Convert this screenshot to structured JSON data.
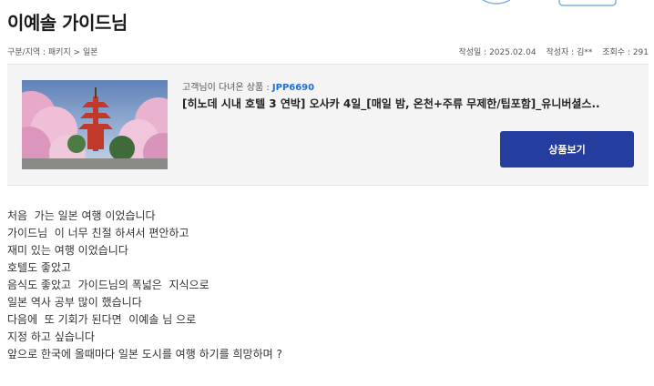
{
  "title": "이예솔 가이드님",
  "breadcrumb": "구분/지역 : 패키지 > 일본",
  "meta": {
    "date": "작성일 : 2025.02.04",
    "author": "작성자 : 김**",
    "views": "조회수 : 291"
  },
  "product": {
    "label": "고객님이 다녀온 상품 : ",
    "code": "JPP6690",
    "title": "[히노데 시내 호텔 3 연박] 오사카 4일_[매일 밤, 온천+주류 무제한/팁포함]_유니버셜스..",
    "button_label": "상품보기",
    "image_icon": "pagoda-cherry-blossom-photo"
  },
  "review_lines": [
    "처음  가는 일본 여행 이었습니다",
    "가이드님  이 너무 친절 하셔서 편안하고",
    "재미 있는 여행 이었습니다",
    "호텔도 좋았고",
    "음식도 좋았고  가이드님의 폭넓은  지식으로",
    "일본 역사 공부 많이 했습니다",
    "다음에  또 기회가 된다면  이예솔 님 으로",
    "지정 하고 싶습니다",
    "앞으로 한국에 올때마다 일본 도시를 여행 하기를 희망하며 ?"
  ],
  "colors": {
    "button": "#243d9e",
    "code": "#1f6fd6",
    "box_bg": "#f4f4f5"
  }
}
